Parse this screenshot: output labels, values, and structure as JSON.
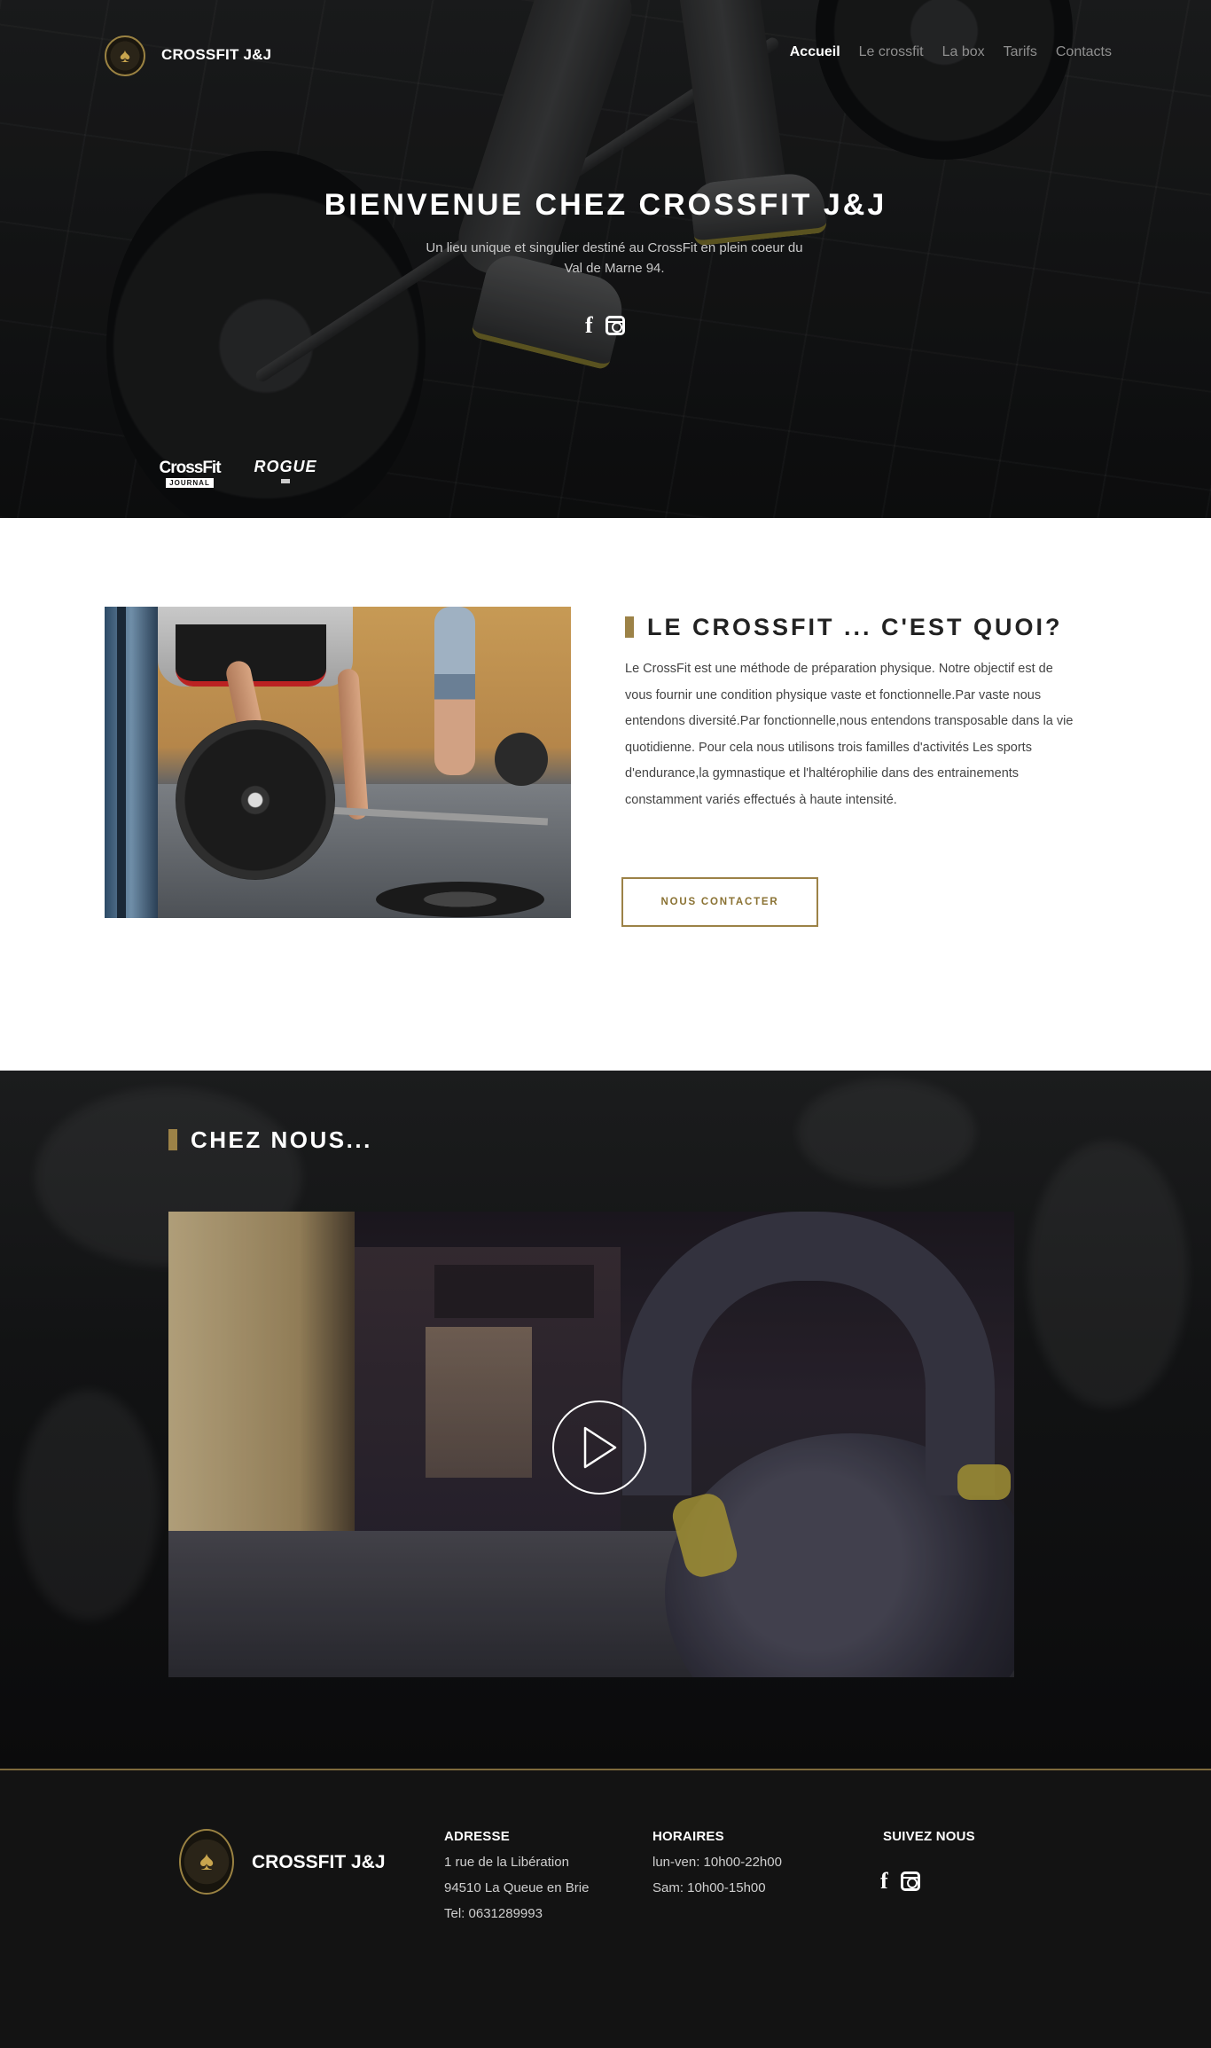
{
  "nav": {
    "brand": "CROSSFIT J&J",
    "items": [
      {
        "label": "Accueil",
        "active": true
      },
      {
        "label": "Le crossfit",
        "active": false
      },
      {
        "label": "La box",
        "active": false
      },
      {
        "label": "Tarifs",
        "active": false
      },
      {
        "label": "Contacts",
        "active": false
      }
    ]
  },
  "hero": {
    "title": "BIENVENUE CHEZ CROSSFIT J&J",
    "subtitle_line1": "Un lieu unique et singulier destiné au CrossFit en plein coeur du",
    "subtitle_line2": "Val de Marne 94.",
    "social_icons": [
      "facebook-icon",
      "instagram-icon"
    ],
    "partners": {
      "crossfit": "CrossFit",
      "journal": "JOURNAL",
      "rogue": "ROGUE"
    }
  },
  "about": {
    "heading": "LE CROSSFIT ... C'EST QUOI?",
    "paragraph": "Le CrossFit est une méthode de préparation physique.  Notre objectif est de vous fournir une condition physique vaste et fonctionnelle.Par vaste nous entendons diversité.Par fonctionnelle,nous entendons transposable dans la vie quotidienne. Pour cela nous utilisons trois familles d'activités Les sports d'endurance,la gymnastique et l'haltérophilie dans des entrainements  constamment  variés effectués à haute intensité.",
    "button": "NOUS CONTACTER"
  },
  "gym": {
    "heading": "CHEZ NOUS...",
    "video_icon": "play-icon"
  },
  "footer": {
    "brand": "CROSSFIT J&J",
    "address": {
      "title": "ADRESSE",
      "line1": "1 rue de la Libération",
      "line2": "94510 La Queue en Brie",
      "line3": "Tel: 0631289993"
    },
    "hours": {
      "title": "HORAIRES",
      "line1": "lun-ven: 10h00-22h00",
      "line2": "Sam: 10h00-15h00"
    },
    "follow": {
      "title": "SUIVEZ NOUS"
    }
  },
  "colors": {
    "accent_gold": "#9c8247",
    "dark_bg": "#131313",
    "text": "#444444"
  }
}
